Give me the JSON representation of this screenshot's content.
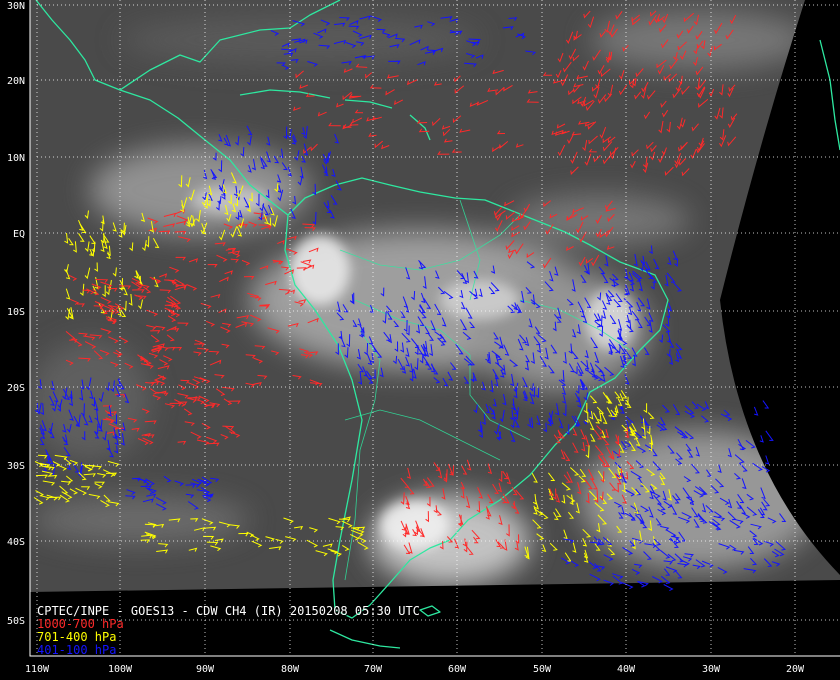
{
  "title": "CPTEC/INPE - GOES13 - CDW CH4 (IR) 20150208 05:30 UTC",
  "legend": [
    {
      "label": "1000-700 hPa",
      "color": "#ff2a2a"
    },
    {
      "label": "701-400 hPa",
      "color": "#ffff00"
    },
    {
      "label": "401-100 hPa",
      "color": "#1414ff"
    }
  ],
  "map": {
    "lon_labels": [
      "110W",
      "100W",
      "90W",
      "80W",
      "70W",
      "60W",
      "50W",
      "40W",
      "30W",
      "20W"
    ],
    "lat_labels": [
      "30N",
      "20N",
      "10N",
      "EQ",
      "10S",
      "20S",
      "30S",
      "40S",
      "50S"
    ],
    "coastline_color": "#2ee8a0",
    "gridline_color": "#ffffff"
  }
}
